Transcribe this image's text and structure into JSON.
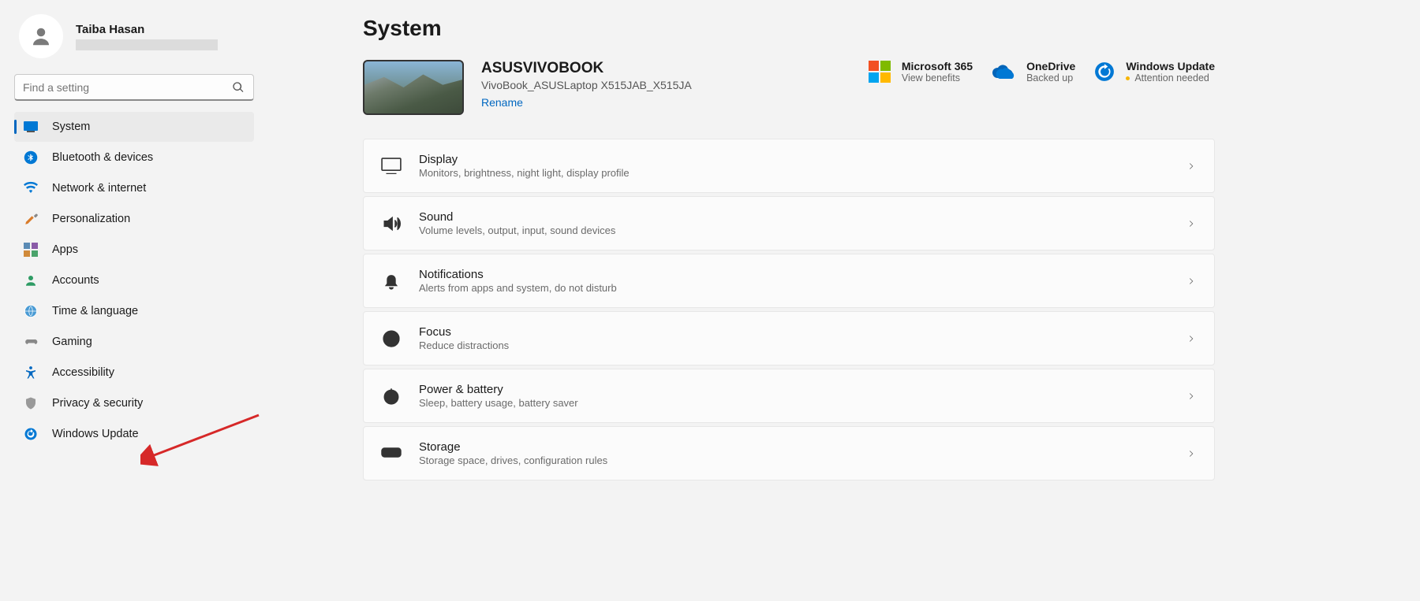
{
  "user": {
    "name": "Taiba Hasan"
  },
  "search": {
    "placeholder": "Find a setting"
  },
  "nav": [
    {
      "label": "System"
    },
    {
      "label": "Bluetooth & devices"
    },
    {
      "label": "Network & internet"
    },
    {
      "label": "Personalization"
    },
    {
      "label": "Apps"
    },
    {
      "label": "Accounts"
    },
    {
      "label": "Time & language"
    },
    {
      "label": "Gaming"
    },
    {
      "label": "Accessibility"
    },
    {
      "label": "Privacy & security"
    },
    {
      "label": "Windows Update"
    }
  ],
  "page": {
    "title": "System"
  },
  "device": {
    "name": "ASUSVIVOBOOK",
    "model": "VivoBook_ASUSLaptop X515JAB_X515JA",
    "rename": "Rename"
  },
  "status": {
    "ms365": {
      "title": "Microsoft 365",
      "sub": "View benefits"
    },
    "onedrive": {
      "title": "OneDrive",
      "sub": "Backed up"
    },
    "update": {
      "title": "Windows Update",
      "sub": "Attention needed"
    }
  },
  "cards": {
    "display": {
      "title": "Display",
      "sub": "Monitors, brightness, night light, display profile"
    },
    "sound": {
      "title": "Sound",
      "sub": "Volume levels, output, input, sound devices"
    },
    "notifications": {
      "title": "Notifications",
      "sub": "Alerts from apps and system, do not disturb"
    },
    "focus": {
      "title": "Focus",
      "sub": "Reduce distractions"
    },
    "power": {
      "title": "Power & battery",
      "sub": "Sleep, battery usage, battery saver"
    },
    "storage": {
      "title": "Storage",
      "sub": "Storage space, drives, configuration rules"
    }
  }
}
